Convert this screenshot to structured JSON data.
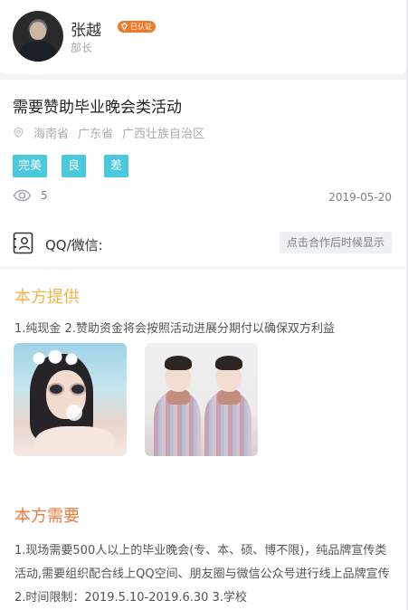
{
  "user": {
    "name": "张越",
    "badge": "已认证",
    "role": "部长"
  },
  "activity": {
    "title": "需要赞助毕业晚会类活动",
    "regions": [
      "海南省",
      "广东省",
      "广西壮族自治区"
    ],
    "tags": [
      "完美",
      "良",
      "差"
    ],
    "views": "5",
    "date": "2019-05-20"
  },
  "contact": {
    "label": "QQ/微信:",
    "hint": "点击合作后时候显示"
  },
  "offer": {
    "title": "本方提供",
    "text": "1.纯现金 2.赞助资金将会按照活动进展分期付以确保双方利益"
  },
  "need": {
    "title": "本方需要",
    "text": "1.现场需要500人以上的毕业晚会(专、本、硕、博不限)，纯品牌宣传类活动,需要组织配合线上QQ空间、朋友圈与微信公众号进行线上品牌宣传 2.时间限制：2019.5.10-2019.6.30 3.学校"
  },
  "colors": {
    "tag": "#4ac8dc",
    "offer_title": "#f2b44a",
    "need_title": "#ec7a3c",
    "badge": "#f07a2b"
  },
  "icons": [
    "location-pin-icon",
    "eye-icon",
    "contact-card-icon",
    "verified-icon"
  ]
}
